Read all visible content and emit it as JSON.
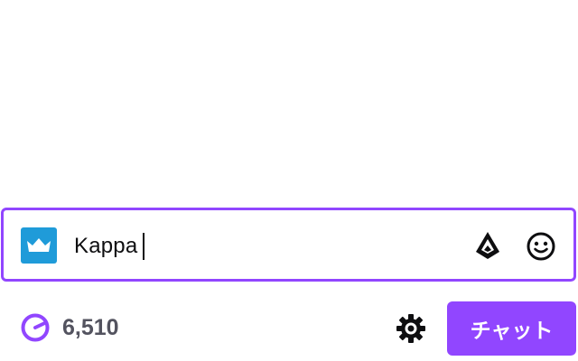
{
  "chat": {
    "input_value": "Kappa",
    "badge_icon": "crown-icon",
    "bits_icon": "bits-gem-icon",
    "emote_icon": "smiley-face-icon"
  },
  "footer": {
    "points_icon": "channel-points-icon",
    "points_value": "6,510",
    "settings_icon": "gear-icon",
    "send_label": "チャット"
  },
  "colors": {
    "accent": "#9146ff",
    "badge_bg": "#1f9bd9",
    "text": "#0e0e10",
    "muted": "#53535f"
  }
}
